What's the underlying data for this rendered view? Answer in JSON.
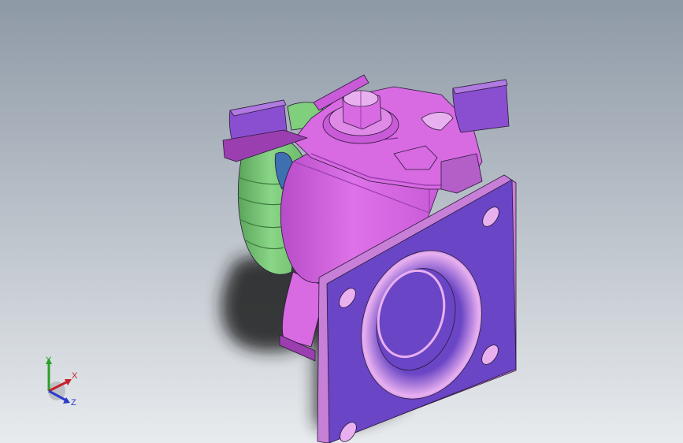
{
  "viewport": {
    "background_top": "#8e99a6",
    "background_bottom": "#e8ebee"
  },
  "model": {
    "colors": {
      "wheel_green": "#7fcf7d",
      "wheel_green_dark": "#4f9a4f",
      "hub_blue": "#3e6fb0",
      "fork_magenta": "#d86ae2",
      "fork_magenta_dark": "#9b3fb0",
      "lever_purple": "#8a4fd0",
      "lever_purple_dark": "#5a2e95",
      "plate_purple": "#6a45c5",
      "plate_edge": "#c77fd8",
      "bearing_light": "#e9b0f0",
      "shadow": "#1b1b1b",
      "edge": "#2a1a3a"
    }
  },
  "triad": {
    "x_label": "X",
    "y_label": "Y",
    "z_label": "Z",
    "x_color": "#c8202a",
    "y_color": "#2aa02a",
    "z_color": "#2a3ac8"
  }
}
